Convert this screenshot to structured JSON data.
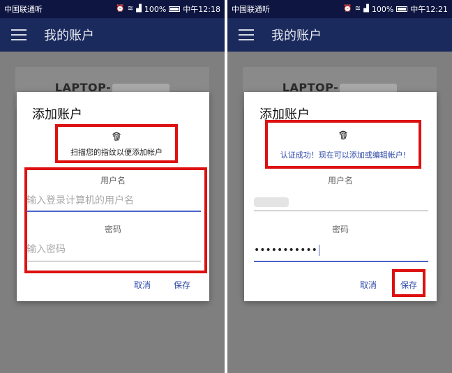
{
  "left": {
    "status": {
      "carrier": "中国联通",
      "carrier_suffix": "听",
      "battery": "100%",
      "time": "中午12:18"
    },
    "appbar": {
      "title": "我的账户"
    },
    "card": {
      "title": "LAPTOP-"
    },
    "dialog": {
      "title": "添加账户",
      "fingerprint_text": "扫描您的指纹以便添加帐户",
      "username_label": "用户名",
      "username_placeholder": "输入登录计算机的用户名",
      "password_label": "密码",
      "password_placeholder": "输入密码",
      "cancel": "取消",
      "save": "保存"
    }
  },
  "right": {
    "status": {
      "carrier": "中国联通",
      "carrier_suffix": "听",
      "battery": "100%",
      "time": "中午12:21"
    },
    "appbar": {
      "title": "我的账户"
    },
    "card": {
      "title": "LAPTOP-"
    },
    "dialog": {
      "title": "添加账户",
      "success_text": "认证成功！现在可以添加或编辑帐户!",
      "username_label": "用户名",
      "password_label": "密码",
      "password_value": "•••••••••••",
      "cancel": "取消",
      "save": "保存"
    }
  },
  "icons": {
    "menu": "hamburger-icon",
    "fingerprint": "fingerprint-icon",
    "alarm": "alarm-icon",
    "wifi": "wifi-icon",
    "signal": "signal-icon",
    "battery": "battery-icon"
  },
  "colors": {
    "appbar": "#1b2a5c",
    "statusbar": "#0d1540",
    "overlay": "#7f7f7f",
    "accent": "#2f4aa8",
    "highlight": "#dd1111",
    "success_text": "#2f4aa8"
  }
}
